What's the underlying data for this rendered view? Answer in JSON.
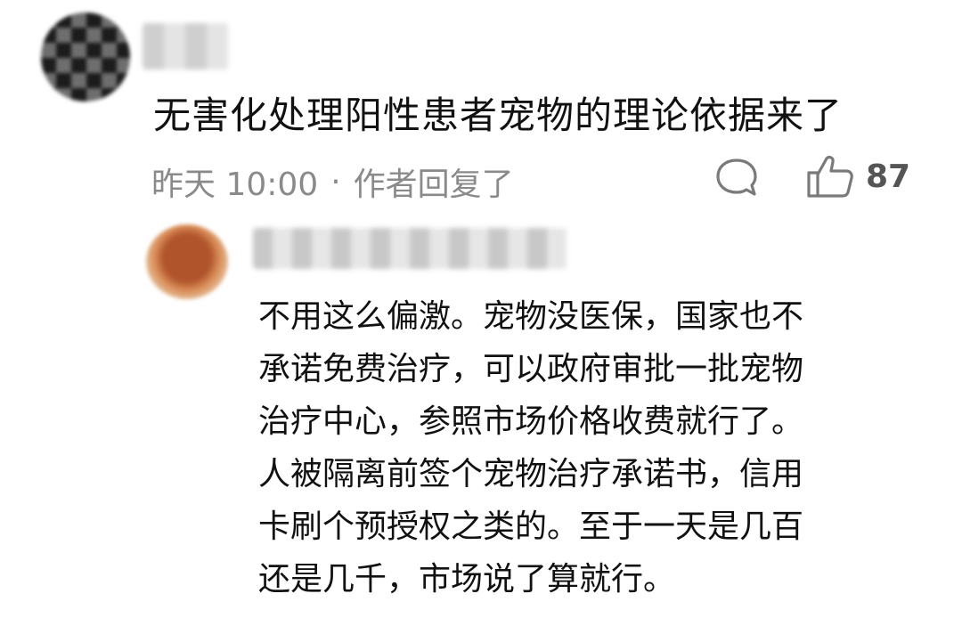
{
  "comment": {
    "avatar": "blurred-avatar",
    "username": "",
    "text": "无害化处理阳性患者宠物的理论依据来了",
    "timestamp": "昨天 10:00",
    "separator": "·",
    "author_replied": "作者回复了",
    "reply_icon": "speech-bubble-icon",
    "like_icon": "thumbs-up-icon",
    "like_count": "87"
  },
  "reply": {
    "avatar": "blurred-avatar",
    "username": "",
    "lines": [
      "不用这么偏激。宠物没医保，国家也不",
      "承诺免费治疗，可以政府审批一批宠物",
      "治疗中心，参照市场价格收费就行了。",
      "人被隔离前签个宠物治疗承诺书，信用",
      "卡刷个预授权之类的。至于一天是几百",
      "还是几千，市场说了算就行。"
    ]
  }
}
